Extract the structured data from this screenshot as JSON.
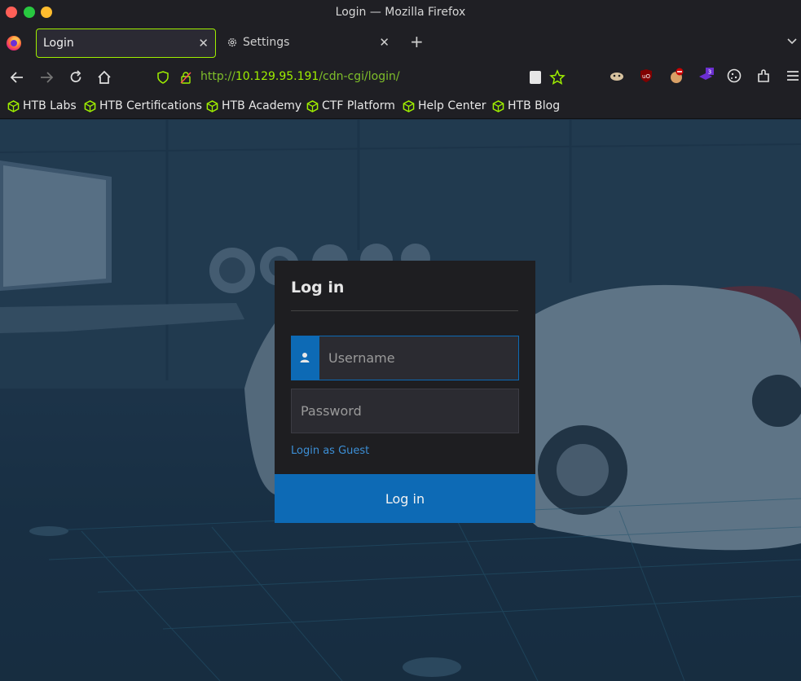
{
  "window": {
    "title": "Login — Mozilla Firefox"
  },
  "tabs": [
    {
      "label": "Login",
      "active": true
    },
    {
      "label": "Settings",
      "active": false
    }
  ],
  "urlbar": {
    "prefix": "http://",
    "host": "10.129.95.191",
    "path": "/cdn-cgi/login/"
  },
  "extensions": {
    "badge_count": "3"
  },
  "bookmarks": [
    {
      "label": "HTB Labs"
    },
    {
      "label": "HTB Certifications"
    },
    {
      "label": "HTB Academy"
    },
    {
      "label": "CTF Platform"
    },
    {
      "label": "Help Center"
    },
    {
      "label": "HTB Blog"
    }
  ],
  "login": {
    "title": "Log in",
    "username_placeholder": "Username",
    "password_placeholder": "Password",
    "guest_link": "Login as Guest",
    "submit_label": "Log in"
  },
  "colors": {
    "accent": "#9fef00",
    "primary": "#0d6ab5",
    "card": "#1e1e21"
  },
  "icons": [
    "firefox-logo",
    "gear-icon",
    "back-icon",
    "forward-icon",
    "reload-icon",
    "home-icon",
    "shield-icon",
    "lock-icon",
    "reader-icon",
    "star-icon",
    "ublock-icon",
    "extensions-icon",
    "menu-icon",
    "user-icon"
  ]
}
